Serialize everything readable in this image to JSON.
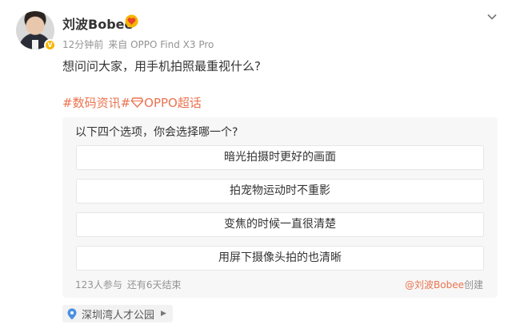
{
  "post": {
    "author": {
      "name": "刘波Bobee",
      "vip_badge_icon": "vip-heart-badge-icon",
      "verified_icon": "verified-v-icon"
    },
    "meta": {
      "time": "12分钟前",
      "source": "来自 OPPO Find X3 Pro"
    },
    "text": "想问问大家，用手机拍照最重视什么?",
    "topics": {
      "first": "#数码资讯#",
      "second_icon": "diamond-super-topic-icon",
      "second": "OPPO超话"
    }
  },
  "poll": {
    "question": "以下四个选项，你会选择哪一个?",
    "options": [
      "暗光拍摄时更好的画面",
      "拍宠物运动时不重影",
      "变焦的时候一直很清楚",
      "用屏下摄像头拍的也清晰"
    ],
    "participants": "123人参与",
    "remaining": "还有6天结束",
    "creator": "@刘波Bobee",
    "creator_suffix": "创建"
  },
  "location": {
    "icon": "location-pin-icon",
    "name": "深圳湾人才公园"
  },
  "colors": {
    "accent": "#eb7350",
    "badge_gold": "#f7b500",
    "pin_blue": "#4a90e2",
    "muted_text": "#939393",
    "poll_bg": "#f7f7f7"
  }
}
